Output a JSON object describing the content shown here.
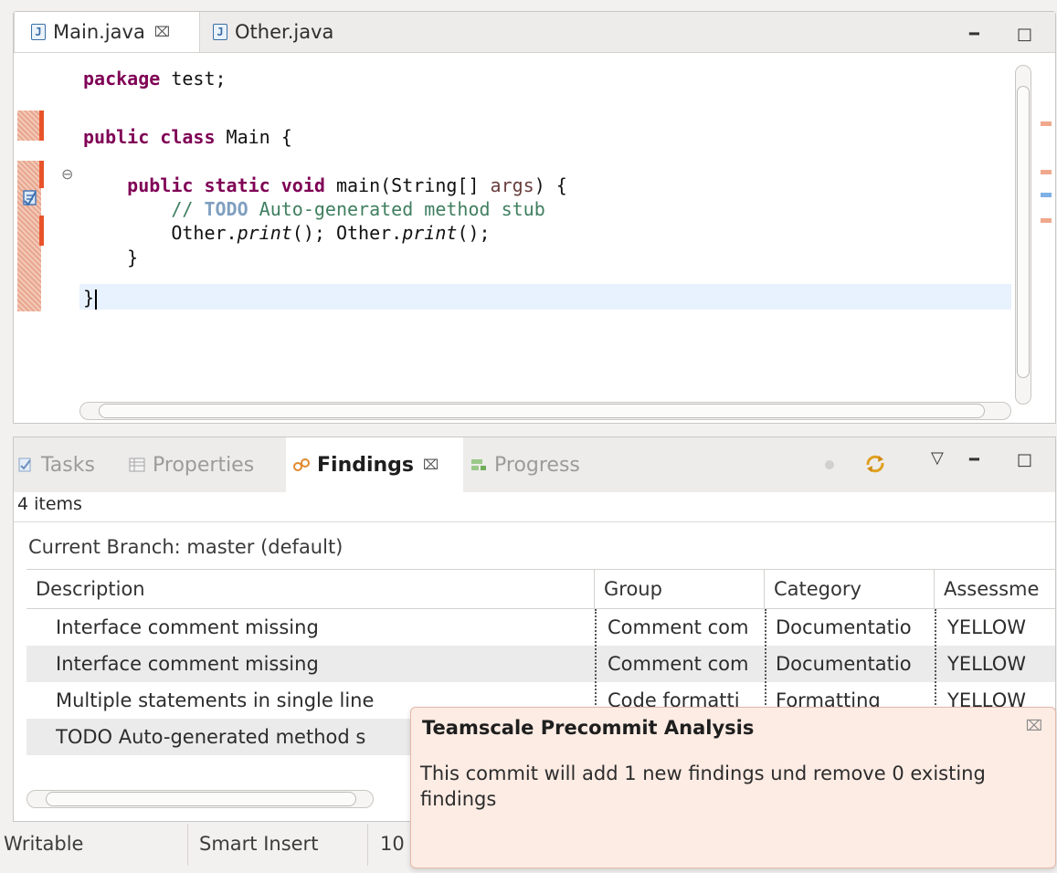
{
  "editor": {
    "tabs": [
      {
        "label": "Main.java",
        "icon": "java-file-icon",
        "active": true
      },
      {
        "label": "Other.java",
        "icon": "java-file-icon",
        "active": false
      }
    ],
    "close_glyph": "⌧",
    "minimize_glyph": "━",
    "maximize_glyph": "□",
    "code": {
      "l1_kw": "package",
      "l1_rest": " test;",
      "l2_kw": "public class",
      "l2_rest": " Main {",
      "l3_kw": "public static void",
      "l3_rest_a": " main(String[] ",
      "l3_args": "args",
      "l3_rest_b": ") {",
      "l4_cm": "// ",
      "l4_todo": "TODO",
      "l4_rest": " Auto-generated method stub",
      "l5_a": "Other.",
      "l5_b": "print",
      "l5_c": "(); Other.",
      "l5_d": "print",
      "l5_e": "();",
      "l6": "}",
      "l7": "}"
    },
    "fold_glyph": "⊖",
    "colors": {
      "keyword": "#7f0055",
      "comment": "#3f7f5f",
      "todo": "#7f9fbf",
      "marker": "#e8532a",
      "current_line": "#e8f2fe"
    }
  },
  "findings_view": {
    "tabs": [
      {
        "label": "Tasks",
        "icon": "tasks-icon"
      },
      {
        "label": "Properties",
        "icon": "properties-icon"
      },
      {
        "label": "Findings",
        "icon": "findings-icon",
        "active": true
      },
      {
        "label": "Progress",
        "icon": "progress-icon"
      }
    ],
    "close_glyph": "⌧",
    "items_count": "4 items",
    "branch": "Current Branch: master (default)",
    "columns": [
      "Description",
      "Group",
      "Category",
      "Assessme"
    ],
    "rows": [
      {
        "description": "Interface comment missing",
        "group": "Comment com",
        "category": "Documentatio",
        "assessment": "YELLOW"
      },
      {
        "description": "Interface comment missing",
        "group": "Comment com",
        "category": "Documentatio",
        "assessment": "YELLOW"
      },
      {
        "description": "Multiple statements in single line",
        "group": "Code formatti",
        "category": "Formatting",
        "assessment": "YELLOW"
      },
      {
        "description": "TODO Auto-generated method s",
        "group": "",
        "category": "",
        "assessment": ""
      }
    ],
    "menu_glyph": "▽"
  },
  "status_bar": {
    "mode": "Writable",
    "insert": "Smart Insert",
    "position": "10"
  },
  "popup": {
    "title": "Teamscale Precommit Analysis",
    "message": "This commit will add 1 new findings und remove 0 existing findings",
    "close_glyph": "⌧"
  }
}
